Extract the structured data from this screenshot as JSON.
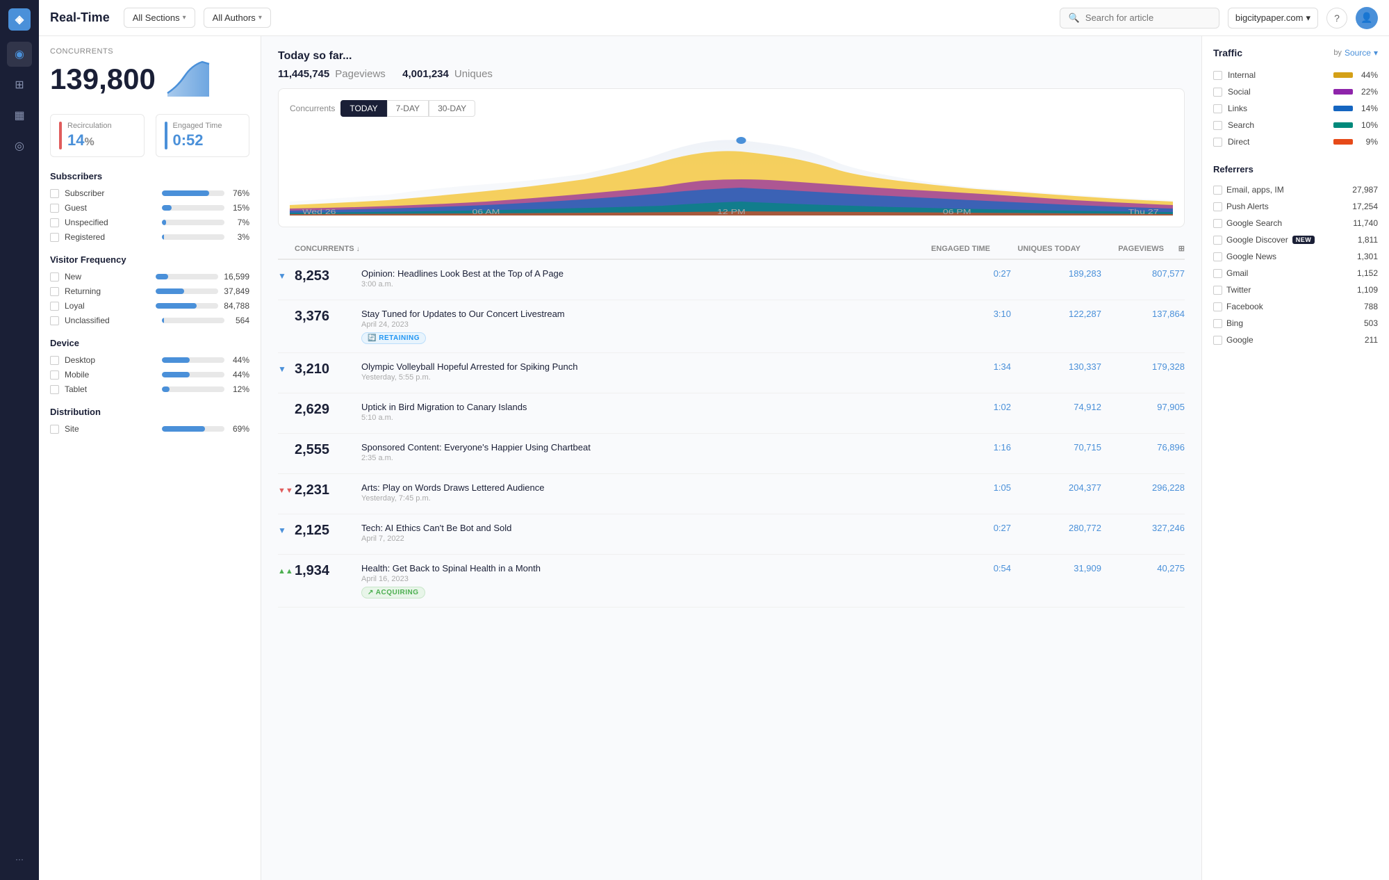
{
  "app": {
    "title": "Real-Time",
    "domain": "bigcitypaper.com"
  },
  "topbar": {
    "title": "Real-Time",
    "all_sections": "All Sections",
    "all_authors": "All Authors",
    "search_placeholder": "Search for article",
    "domain": "bigcitypaper.com"
  },
  "sidebar": {
    "concurrents_label": "Concurrents",
    "concurrents_value": "139,800",
    "recirculation_label": "Recirculation",
    "recirculation_value": "14",
    "recirculation_unit": "%",
    "engaged_time_label": "Engaged Time",
    "engaged_time_value": "0:52",
    "subscribers": {
      "title": "Subscribers",
      "items": [
        {
          "label": "Subscriber",
          "pct": "76%",
          "bar_width": "76%"
        },
        {
          "label": "Guest",
          "pct": "15%",
          "bar_width": "15%"
        },
        {
          "label": "Unspecified",
          "pct": "7%",
          "bar_width": "7%"
        },
        {
          "label": "Registered",
          "pct": "3%",
          "bar_width": "3%"
        }
      ]
    },
    "visitor_frequency": {
      "title": "Visitor Frequency",
      "items": [
        {
          "label": "New",
          "value": "16,599",
          "bar_width": "20%"
        },
        {
          "label": "Returning",
          "value": "37,849",
          "bar_width": "45%"
        },
        {
          "label": "Loyal",
          "value": "84,788",
          "bar_width": "65%"
        },
        {
          "label": "Unclassified",
          "value": "564",
          "bar_width": "3%"
        }
      ]
    },
    "device": {
      "title": "Device",
      "items": [
        {
          "label": "Desktop",
          "pct": "44%",
          "bar_width": "44%"
        },
        {
          "label": "Mobile",
          "pct": "44%",
          "bar_width": "44%"
        },
        {
          "label": "Tablet",
          "pct": "12%",
          "bar_width": "12%"
        }
      ]
    },
    "distribution": {
      "title": "Distribution",
      "items": [
        {
          "label": "Site",
          "pct": "69%",
          "bar_width": "69%"
        }
      ]
    }
  },
  "chart": {
    "today_label": "Today so far...",
    "pageviews_count": "11,445,745",
    "pageviews_label": "Pageviews",
    "uniques_count": "4,001,234",
    "uniques_label": "Uniques",
    "tabs_label": "Concurrents",
    "tabs": [
      {
        "label": "TODAY",
        "active": true
      },
      {
        "label": "7-DAY",
        "active": false
      },
      {
        "label": "30-DAY",
        "active": false
      }
    ]
  },
  "table": {
    "headers": {
      "concurrents": "Concurrents",
      "engaged_time": "Engaged Time",
      "uniques_today": "Uniques Today",
      "pageviews": "Pageviews"
    },
    "articles": [
      {
        "id": 1,
        "arrow": "▼",
        "arrow_type": "down",
        "concurrents": "8,253",
        "title": "Opinion: Headlines Look Best at the Top of A Page",
        "date": "3:00 a.m.",
        "badge": null,
        "engaged_time": "0:27",
        "uniques": "189,283",
        "pageviews": "807,577"
      },
      {
        "id": 2,
        "arrow": "",
        "arrow_type": "none",
        "concurrents": "3,376",
        "title": "Stay Tuned for Updates to Our Concert Livestream",
        "date": "April 24, 2023",
        "badge": "RETAINING",
        "badge_type": "retaining",
        "engaged_time": "3:10",
        "uniques": "122,287",
        "pageviews": "137,864"
      },
      {
        "id": 3,
        "arrow": "▼",
        "arrow_type": "down",
        "concurrents": "3,210",
        "title": "Olympic Volleyball Hopeful Arrested for Spiking Punch",
        "date": "Yesterday, 5:55 p.m.",
        "badge": null,
        "engaged_time": "1:34",
        "uniques": "130,337",
        "pageviews": "179,328"
      },
      {
        "id": 4,
        "arrow": "",
        "arrow_type": "none",
        "concurrents": "2,629",
        "title": "Uptick in Bird Migration to Canary Islands",
        "date": "5:10 a.m.",
        "badge": null,
        "engaged_time": "1:02",
        "uniques": "74,912",
        "pageviews": "97,905"
      },
      {
        "id": 5,
        "arrow": "",
        "arrow_type": "none",
        "concurrents": "2,555",
        "title": "Sponsored Content: Everyone's Happier Using Chartbeat",
        "date": "2:35 a.m.",
        "badge": null,
        "engaged_time": "1:16",
        "uniques": "70,715",
        "pageviews": "76,896"
      },
      {
        "id": 6,
        "arrow": "▼▼",
        "arrow_type": "double-down",
        "concurrents": "2,231",
        "title": "Arts: Play on Words Draws Lettered Audience",
        "date": "Yesterday, 7:45 p.m.",
        "badge": null,
        "engaged_time": "1:05",
        "uniques": "204,377",
        "pageviews": "296,228"
      },
      {
        "id": 7,
        "arrow": "▼",
        "arrow_type": "down",
        "concurrents": "2,125",
        "title": "Tech: AI Ethics Can't Be Bot and Sold",
        "date": "April 7, 2022",
        "badge": null,
        "engaged_time": "0:27",
        "uniques": "280,772",
        "pageviews": "327,246"
      },
      {
        "id": 8,
        "arrow": "▲▲",
        "arrow_type": "double-up",
        "concurrents": "1,934",
        "title": "Health: Get Back to Spinal Health in a Month",
        "date": "April 16, 2023",
        "badge": "ACQUIRING",
        "badge_type": "acquiring",
        "engaged_time": "0:54",
        "uniques": "31,909",
        "pageviews": "40,275"
      }
    ]
  },
  "traffic": {
    "title": "Traffic",
    "by_label": "by",
    "filter_label": "Source",
    "items": [
      {
        "label": "Internal",
        "color": "#d4a017",
        "pct": "44%"
      },
      {
        "label": "Social",
        "color": "#8e24aa",
        "pct": "22%"
      },
      {
        "label": "Links",
        "color": "#1565c0",
        "pct": "14%"
      },
      {
        "label": "Search",
        "color": "#00897b",
        "pct": "10%"
      },
      {
        "label": "Direct",
        "color": "#e64a19",
        "pct": "9%"
      }
    ]
  },
  "referrers": {
    "title": "Referrers",
    "items": [
      {
        "label": "Email, apps, IM",
        "count": "27,987",
        "is_new": false
      },
      {
        "label": "Push Alerts",
        "count": "17,254",
        "is_new": false
      },
      {
        "label": "Google Search",
        "count": "11,740",
        "is_new": false
      },
      {
        "label": "Google Discover",
        "count": "1,811",
        "is_new": true
      },
      {
        "label": "Google News",
        "count": "1,301",
        "is_new": false
      },
      {
        "label": "Gmail",
        "count": "1,152",
        "is_new": false
      },
      {
        "label": "Twitter",
        "count": "1,109",
        "is_new": false
      },
      {
        "label": "Facebook",
        "count": "788",
        "is_new": false
      },
      {
        "label": "Bing",
        "count": "503",
        "is_new": false
      },
      {
        "label": "Google",
        "count": "211",
        "is_new": false
      }
    ]
  },
  "nav": {
    "icons": [
      {
        "name": "logo",
        "symbol": "◈"
      },
      {
        "name": "realtime",
        "symbol": "◉",
        "active": true
      },
      {
        "name": "chart",
        "symbol": "▦"
      },
      {
        "name": "target",
        "symbol": "◎"
      },
      {
        "name": "more",
        "symbol": "···"
      }
    ]
  }
}
